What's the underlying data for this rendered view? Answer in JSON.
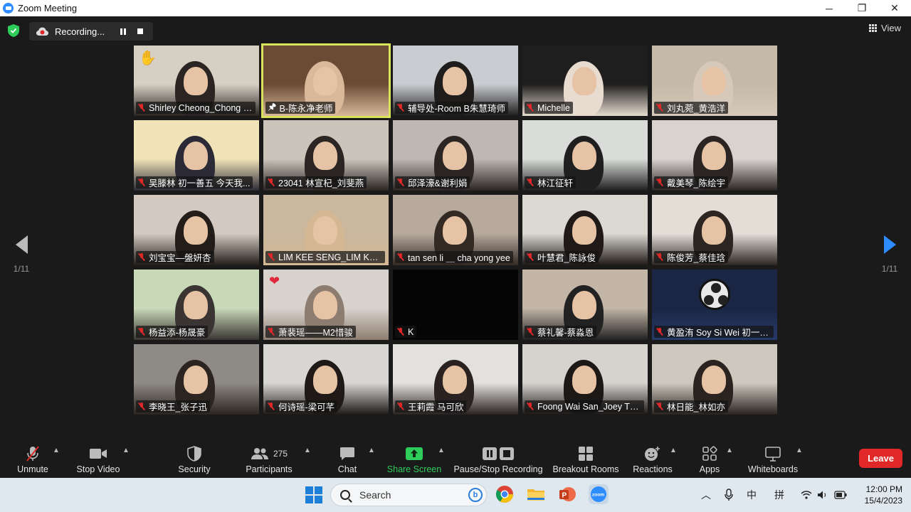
{
  "window": {
    "title": "Zoom Meeting"
  },
  "window_controls": [
    "─",
    "❐",
    "✕"
  ],
  "recording": {
    "label": "Recording..."
  },
  "view": {
    "label": "View"
  },
  "pager": {
    "left": "1/11",
    "right": "1/11"
  },
  "tiles": [
    {
      "name": "Shirley Cheong_Chong Q...",
      "muted": true,
      "pinned": false,
      "active": false,
      "reaction": "✋",
      "colors": [
        "#d6cfc4",
        "#2a2522"
      ]
    },
    {
      "name": "B-陈永净老师",
      "muted": false,
      "pinned": true,
      "active": true,
      "reaction": "",
      "colors": [
        "#6b4b34",
        "#d9b99a"
      ]
    },
    {
      "name": "辅导处-Room B朱慧琦师",
      "muted": true,
      "pinned": false,
      "active": false,
      "reaction": "",
      "colors": [
        "#c9ccd0",
        "#1f1d1c"
      ]
    },
    {
      "name": "Michelle",
      "muted": true,
      "pinned": false,
      "active": false,
      "reaction": "",
      "colors": [
        "#1e1e1e",
        "#e8dcd0"
      ]
    },
    {
      "name": "刘丸菀_黄浩洋",
      "muted": true,
      "pinned": false,
      "active": false,
      "reaction": "",
      "colors": [
        "#c5b9a8",
        "#d6c9b9"
      ]
    },
    {
      "name": "吴滕林 初一善五 今天我...",
      "muted": true,
      "pinned": false,
      "active": false,
      "reaction": "",
      "colors": [
        "#f1e3b8",
        "#2c2a36"
      ]
    },
    {
      "name": "23041 林宣杞_刘斐燕",
      "muted": true,
      "pinned": false,
      "active": false,
      "reaction": "",
      "colors": [
        "#cbc4bb",
        "#2b2523"
      ]
    },
    {
      "name": "邱泽濠&谢利娟",
      "muted": true,
      "pinned": false,
      "active": false,
      "reaction": "",
      "colors": [
        "#bdb8b3",
        "#2b2624"
      ]
    },
    {
      "name": "林江征轩",
      "muted": true,
      "pinned": false,
      "active": false,
      "reaction": "",
      "colors": [
        "#d9dcd9",
        "#1f1f1f"
      ]
    },
    {
      "name": "戴美琴_陈绘宇",
      "muted": true,
      "pinned": false,
      "active": false,
      "reaction": "",
      "colors": [
        "#d8d3cf",
        "#2a2423"
      ]
    },
    {
      "name": "刘宝宝—盤妍杏",
      "muted": true,
      "pinned": false,
      "active": false,
      "reaction": "",
      "colors": [
        "#d3c9c0",
        "#231d1a"
      ]
    },
    {
      "name": "LIM KEE SENG_LIM KE RU",
      "muted": true,
      "pinned": false,
      "active": false,
      "reaction": "",
      "colors": [
        "#c9b79e",
        "#d4b793"
      ]
    },
    {
      "name": "tan sen li ＿ cha yong yee",
      "muted": true,
      "pinned": false,
      "active": false,
      "reaction": "",
      "colors": [
        "#b7aa9d",
        "#332a24"
      ]
    },
    {
      "name": "叶慧君_陈詠俊",
      "muted": true,
      "pinned": false,
      "active": false,
      "reaction": "",
      "colors": [
        "#dcd8d2",
        "#1f1a17"
      ]
    },
    {
      "name": "陈俊芳_蔡佳琀",
      "muted": true,
      "pinned": false,
      "active": false,
      "reaction": "",
      "colors": [
        "#e4ddd6",
        "#2d2522"
      ]
    },
    {
      "name": "杨益添-杨晟豪",
      "muted": true,
      "pinned": false,
      "active": false,
      "reaction": "",
      "colors": [
        "#c8d9b8",
        "#3a3533"
      ]
    },
    {
      "name": "萧裴瑶——M2惜骏",
      "muted": true,
      "pinned": false,
      "active": false,
      "reaction": "heart",
      "colors": [
        "#d9d2cc",
        "#8d7d70"
      ]
    },
    {
      "name": "K",
      "muted": true,
      "pinned": false,
      "active": false,
      "reaction": "",
      "colors": [
        "#050505",
        "#050505"
      ]
    },
    {
      "name": "蔡礼馨-蔡淼恩",
      "muted": true,
      "pinned": false,
      "active": false,
      "reaction": "",
      "colors": [
        "#c3b6a7",
        "#222"
      ]
    },
    {
      "name": "黄盈洧 Soy Si Wei 初一善...",
      "muted": true,
      "pinned": false,
      "active": false,
      "reaction": "obs",
      "colors": [
        "#1b2644",
        "#273a6a"
      ]
    },
    {
      "name": "李晓王_张子迅",
      "muted": true,
      "pinned": false,
      "active": false,
      "reaction": "",
      "colors": [
        "#8e8a85",
        "#2b2421"
      ]
    },
    {
      "name": "何诗瑶-梁可芊",
      "muted": true,
      "pinned": false,
      "active": false,
      "reaction": "",
      "colors": [
        "#d8d6d3",
        "#1f1a18"
      ]
    },
    {
      "name": "王莉霞 马可欣",
      "muted": true,
      "pinned": false,
      "active": false,
      "reaction": "",
      "colors": [
        "#e3e1de",
        "#2a2220"
      ]
    },
    {
      "name": "Foong Wai San_Joey The...",
      "muted": true,
      "pinned": false,
      "active": false,
      "reaction": "",
      "colors": [
        "#d6d3cf",
        "#1c1816"
      ]
    },
    {
      "name": "林日能_林如亦",
      "muted": true,
      "pinned": false,
      "active": false,
      "reaction": "",
      "colors": [
        "#cfc8be",
        "#2a2320"
      ]
    }
  ],
  "toolbar": {
    "unmute": "Unmute",
    "stop_video": "Stop Video",
    "security": "Security",
    "participants": "Participants",
    "participants_count": "275",
    "chat": "Chat",
    "share_screen": "Share Screen",
    "pause_stop_recording": "Pause/Stop Recording",
    "breakout_rooms": "Breakout Rooms",
    "reactions": "Reactions",
    "apps": "Apps",
    "whiteboards": "Whiteboards",
    "leave": "Leave"
  },
  "taskbar": {
    "search_label": "Search",
    "ime_lang": "中",
    "ime_mode": "拼",
    "time": "12:00 PM",
    "date": "15/4/2023"
  },
  "colors": {
    "accent_blue": "#2d8cff",
    "active_speaker_border": "#d8e25a",
    "muted_red": "#e02828",
    "share_green": "#2ecc5b",
    "leave_red": "#e02828"
  }
}
